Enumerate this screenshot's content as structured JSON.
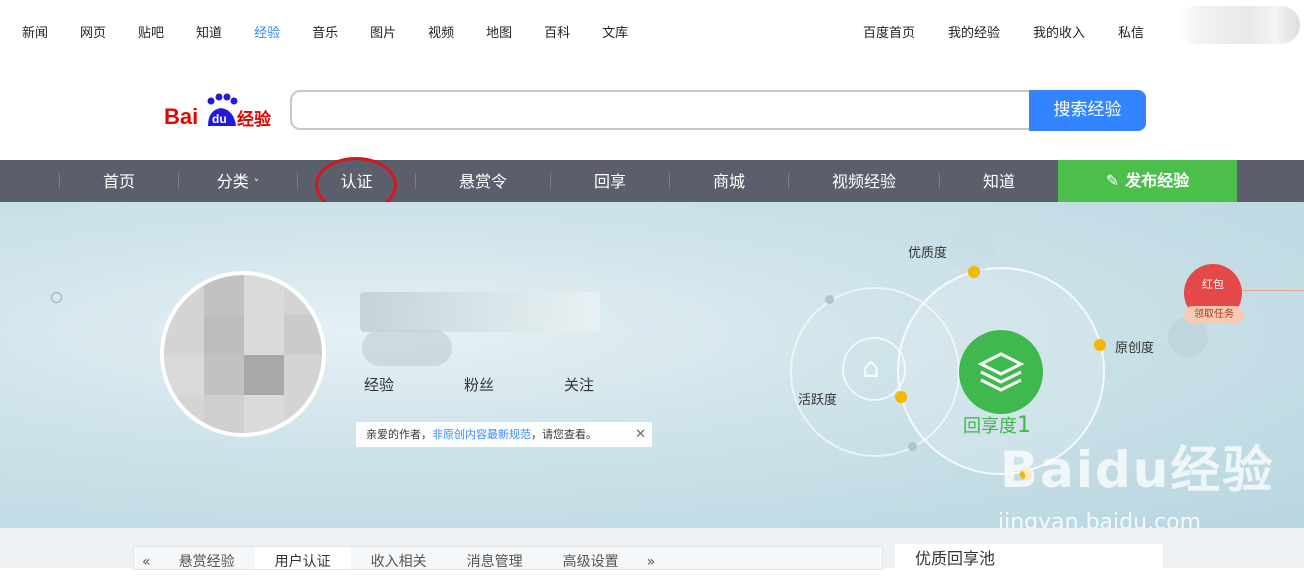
{
  "top_nav": {
    "links": [
      "新闻",
      "网页",
      "贴吧",
      "知道",
      "经验",
      "音乐",
      "图片",
      "视频",
      "地图",
      "百科",
      "文库"
    ],
    "active_index": 4,
    "right_links": [
      "百度首页",
      "我的经验",
      "我的收入",
      "私信"
    ]
  },
  "search": {
    "value": "",
    "button_label": "搜索经验"
  },
  "logo": {
    "bai": "Bai",
    "du": "du",
    "suffix": "经验"
  },
  "main_nav": {
    "items": [
      "首页",
      "分类",
      "认证",
      "悬赏令",
      "回享",
      "商城",
      "视频经验",
      "知道"
    ],
    "dropdown_mark": "˅",
    "publish_label": "发布经验"
  },
  "profile": {
    "stats": [
      "经验",
      "粉丝",
      "关注"
    ],
    "notice": {
      "prefix": "亲爱的作者，",
      "link": "非原创内容最新规范",
      "suffix": "，请您查看。",
      "close": "✕"
    }
  },
  "radar": {
    "labels": {
      "quality": "优质度",
      "originality": "原创度",
      "activity": "活跃度"
    },
    "score_label": "回享度",
    "score_value": "1"
  },
  "redpack": {
    "title": "红包",
    "action": "领取任务"
  },
  "watermark": {
    "text": "Baidu经验",
    "url": "jingyan.baidu.com"
  },
  "bottom_tabs": {
    "prev": "«",
    "items": [
      "悬赏经验",
      "用户认证",
      "收入相关",
      "消息管理",
      "高级设置"
    ],
    "next": "»",
    "active_index": 1,
    "side_title": "优质回享池"
  },
  "colors": {
    "accent": "#3385ff",
    "nav_bg": "#5a5f6b",
    "publish_bg": "#4cbf4b",
    "highlight_circle": "#d8151c"
  }
}
